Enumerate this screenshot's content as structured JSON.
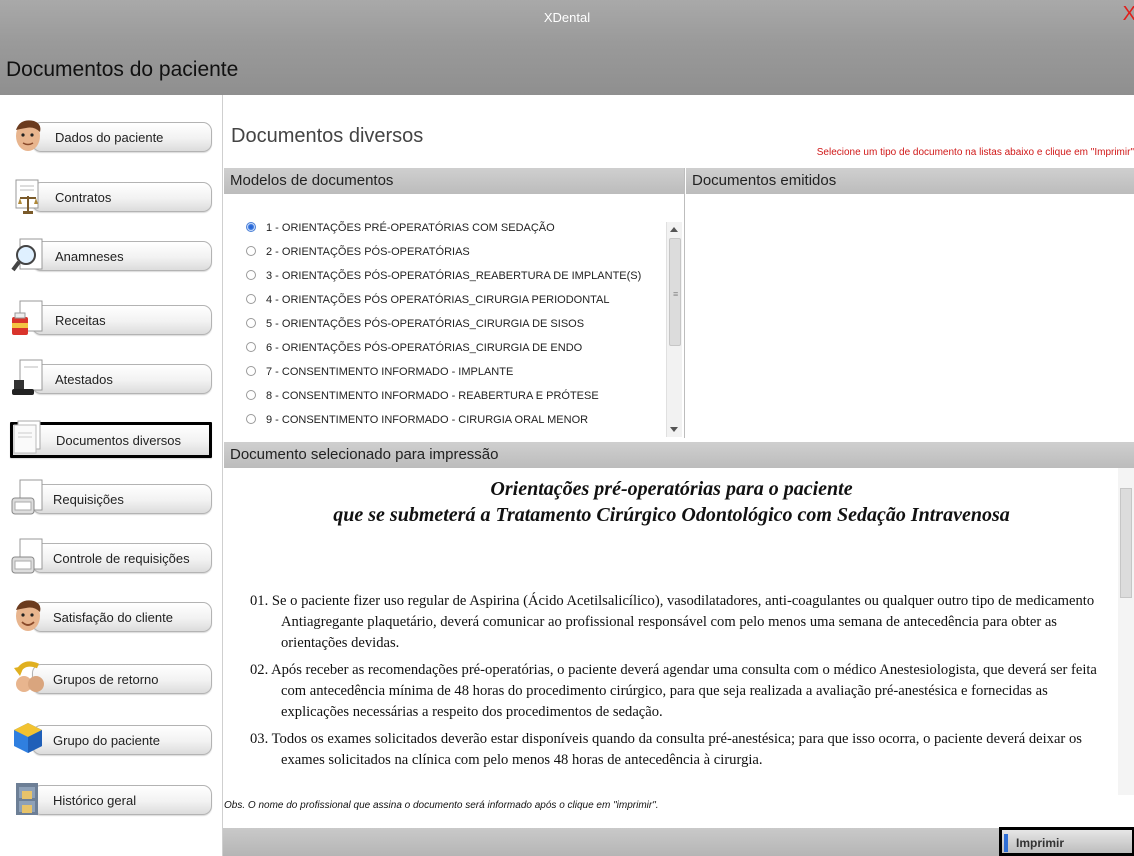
{
  "app": {
    "title": "XDental",
    "close_glyph": "X",
    "window_title": "Documentos do paciente"
  },
  "sidebar": {
    "items": [
      {
        "label": "Dados do paciente",
        "icon": "patient-face-icon"
      },
      {
        "label": "Contratos",
        "icon": "contract-scales-icon"
      },
      {
        "label": "Anamneses",
        "icon": "magnifier-document-icon"
      },
      {
        "label": "Receitas",
        "icon": "prescription-icon"
      },
      {
        "label": "Atestados",
        "icon": "certificate-stamp-icon"
      },
      {
        "label": "Documentos diversos",
        "icon": "documents-icon",
        "active": true
      },
      {
        "label": "Requisições",
        "icon": "requisition-icon"
      },
      {
        "label": "Controle de requisições",
        "icon": "requisition-control-icon"
      },
      {
        "label": "Satisfação do cliente",
        "icon": "smiley-face-icon"
      },
      {
        "label": "Grupos de retorno",
        "icon": "return-group-icon"
      },
      {
        "label": "Grupo do paciente",
        "icon": "patient-group-cube-icon"
      },
      {
        "label": "Histórico geral",
        "icon": "history-cabinet-icon"
      }
    ]
  },
  "main": {
    "section_title": "Documentos diversos",
    "hint": "Selecione um tipo de documento na listas abaixo e clique em \"Imprimir\"",
    "models_header": "Modelos de documentos",
    "issued_header": "Documentos emitidos",
    "models": [
      {
        "label": "1 - ORIENTAÇÕES PRÉ-OPERATÓRIAS COM SEDAÇÃO",
        "selected": true
      },
      {
        "label": "2 - ORIENTAÇÕES PÓS-OPERATÓRIAS",
        "selected": false
      },
      {
        "label": "3 - ORIENTAÇÕES PÓS-OPERATÓRIAS_REABERTURA DE IMPLANTE(S)",
        "selected": false
      },
      {
        "label": "4 - ORIENTAÇÕES PÓS OPERATÓRIAS_CIRURGIA PERIODONTAL",
        "selected": false
      },
      {
        "label": "5 - ORIENTAÇÕES PÓS-OPERATÓRIAS_CIRURGIA DE SISOS",
        "selected": false
      },
      {
        "label": "6 - ORIENTAÇÕES PÓS-OPERATÓRIAS_CIRURGIA DE ENDO",
        "selected": false
      },
      {
        "label": "7 - CONSENTIMENTO INFORMADO - IMPLANTE",
        "selected": false
      },
      {
        "label": "8 - CONSENTIMENTO INFORMADO - REABERTURA E PRÓTESE",
        "selected": false
      },
      {
        "label": "9 - CONSENTIMENTO INFORMADO - CIRURGIA ORAL MENOR",
        "selected": false
      }
    ],
    "print_header": "Documento selecionado para impressão",
    "document": {
      "title_line1": "Orientações pré-operatórias para o paciente",
      "title_line2": "que se submeterá a  Tratamento Cirúrgico Odontológico com Sedação Intravenosa",
      "paragraphs": [
        {
          "num": "01.",
          "text": "Se o paciente fizer uso regular de Aspirina (Ácido Acetilsalicílico), vasodilatadores, anti-coagulantes ou qualquer outro tipo de medicamento Antiagregante plaquetário, deverá comunicar ao profissional responsável com pelo menos uma semana de antecedência para obter as orientações devidas."
        },
        {
          "num": "02.",
          "text": "Após receber as recomendações pré-operatórias, o paciente deverá agendar uma consulta com o médico Anestesiologista, que deverá ser feita com antecedência mínima de 48 horas do procedimento cirúrgico, para que seja realizada a avaliação pré-anestésica e fornecidas as explicações necessárias a respeito dos procedimentos de sedação."
        },
        {
          "num": "03.",
          "text": "Todos os exames solicitados deverão estar disponíveis quando da consulta pré-anestésica; para que isso ocorra, o paciente deverá deixar os exames solicitados na clínica com pelo menos 48 horas de antecedência à cirurgia."
        }
      ]
    },
    "obs": "Obs. O nome do profissional que assina o documento será informado após o clique em \"imprimir\".",
    "print_button": "Imprimir"
  },
  "colors": {
    "accent": "#2f6fd6",
    "hint_red": "#d01818",
    "close_red": "#e0201c"
  }
}
